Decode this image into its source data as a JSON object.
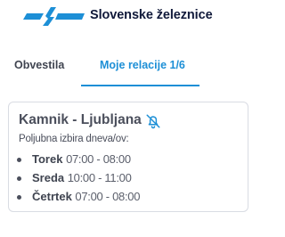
{
  "header": {
    "brand_name": "Slovenske železnice",
    "logo_icon": "sz-logo-icon",
    "brand_color": "#1d8fd6"
  },
  "tabs": [
    {
      "label": "Obvestila",
      "active": false
    },
    {
      "label": "Moje relacije 1/6",
      "active": true
    }
  ],
  "route_card": {
    "title": "Kamnik - Ljubljana",
    "notification_icon": "bell-off-icon",
    "subtitle": "Poljubna izbira dneva/ov:",
    "slots": [
      {
        "day": "Torek",
        "time": "07:00 - 08:00"
      },
      {
        "day": "Sreda",
        "time": "10:00 - 11:00"
      },
      {
        "day": "Četrtek",
        "time": "07:00 - 08:00"
      }
    ]
  }
}
